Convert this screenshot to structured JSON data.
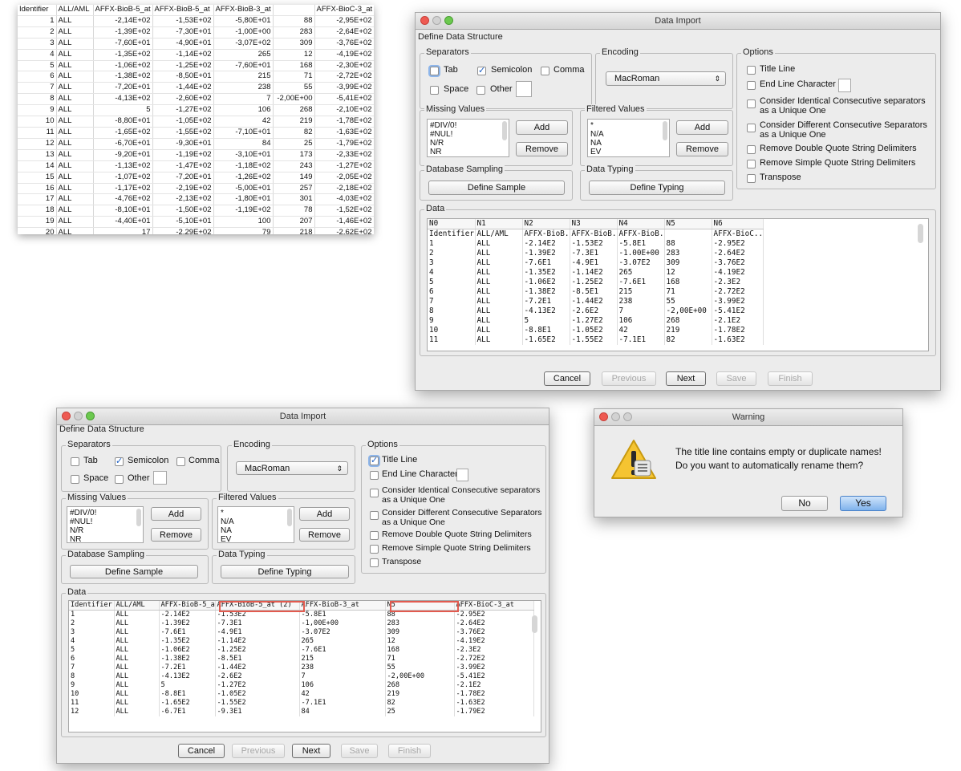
{
  "sheet": {
    "headers": [
      "Identifier",
      "ALL/AML",
      "AFFX-BioB-5_at",
      "AFFX-BioB-5_at",
      "AFFX-BioB-3_at",
      "",
      "AFFX-BioC-3_at"
    ],
    "rows": [
      [
        "1",
        "ALL",
        "-2,14E+02",
        "-1,53E+02",
        "-5,80E+01",
        "88",
        "-2,95E+02"
      ],
      [
        "2",
        "ALL",
        "-1,39E+02",
        "-7,30E+01",
        "-1,00E+00",
        "283",
        "-2,64E+02"
      ],
      [
        "3",
        "ALL",
        "-7,60E+01",
        "-4,90E+01",
        "-3,07E+02",
        "309",
        "-3,76E+02"
      ],
      [
        "4",
        "ALL",
        "-1,35E+02",
        "-1,14E+02",
        "265",
        "12",
        "-4,19E+02"
      ],
      [
        "5",
        "ALL",
        "-1,06E+02",
        "-1,25E+02",
        "-7,60E+01",
        "168",
        "-2,30E+02"
      ],
      [
        "6",
        "ALL",
        "-1,38E+02",
        "-8,50E+01",
        "215",
        "71",
        "-2,72E+02"
      ],
      [
        "7",
        "ALL",
        "-7,20E+01",
        "-1,44E+02",
        "238",
        "55",
        "-3,99E+02"
      ],
      [
        "8",
        "ALL",
        "-4,13E+02",
        "-2,60E+02",
        "7",
        "-2,00E+00",
        "-5,41E+02"
      ],
      [
        "9",
        "ALL",
        "5",
        "-1,27E+02",
        "106",
        "268",
        "-2,10E+02"
      ],
      [
        "10",
        "ALL",
        "-8,80E+01",
        "-1,05E+02",
        "42",
        "219",
        "-1,78E+02"
      ],
      [
        "11",
        "ALL",
        "-1,65E+02",
        "-1,55E+02",
        "-7,10E+01",
        "82",
        "-1,63E+02"
      ],
      [
        "12",
        "ALL",
        "-6,70E+01",
        "-9,30E+01",
        "84",
        "25",
        "-1,79E+02"
      ],
      [
        "13",
        "ALL",
        "-9,20E+01",
        "-1,19E+02",
        "-3,10E+01",
        "173",
        "-2,33E+02"
      ],
      [
        "14",
        "ALL",
        "-1,13E+02",
        "-1,47E+02",
        "-1,18E+02",
        "243",
        "-1,27E+02"
      ],
      [
        "15",
        "ALL",
        "-1,07E+02",
        "-7,20E+01",
        "-1,26E+02",
        "149",
        "-2,05E+02"
      ],
      [
        "16",
        "ALL",
        "-1,17E+02",
        "-2,19E+02",
        "-5,00E+01",
        "257",
        "-2,18E+02"
      ],
      [
        "17",
        "ALL",
        "-4,76E+02",
        "-2,13E+02",
        "-1,80E+01",
        "301",
        "-4,03E+02"
      ],
      [
        "18",
        "ALL",
        "-8,10E+01",
        "-1,50E+02",
        "-1,19E+02",
        "78",
        "-1,52E+02"
      ],
      [
        "19",
        "ALL",
        "-4,40E+01",
        "-5,10E+01",
        "100",
        "207",
        "-1,46E+02"
      ],
      [
        "20",
        "ALL",
        "17",
        "-2,29E+02",
        "79",
        "218",
        "-2,62E+02"
      ]
    ]
  },
  "dialog1": {
    "title": "Data Import",
    "subheader": "Define Data Structure",
    "separators": {
      "legend": "Separators",
      "tab": "Tab",
      "semicolon": "Semicolon",
      "comma": "Comma",
      "space": "Space",
      "other": "Other"
    },
    "encoding": {
      "legend": "Encoding",
      "value": "MacRoman"
    },
    "options": {
      "legend": "Options",
      "title_line": "Title Line",
      "end_line": "End Line Character",
      "identical_1": "Consider Identical Consecutive separators",
      "identical_2": "as a Unique One",
      "different_1": "Consider Different Consecutive Separators",
      "different_2": "as a Unique One",
      "double_quote": "Remove Double Quote String Delimiters",
      "simple_quote": "Remove Simple Quote String Delimiters",
      "transpose": "Transpose"
    },
    "missing": {
      "legend": "Missing Values",
      "items": [
        "#DIV/0!",
        "#NUL!",
        "N/R",
        "NR"
      ],
      "add": "Add",
      "remove": "Remove"
    },
    "filtered": {
      "legend": "Filtered Values",
      "items": [
        "*",
        "N/A",
        "NA",
        "EV"
      ],
      "add": "Add",
      "remove": "Remove"
    },
    "sampling": {
      "legend": "Database Sampling",
      "button": "Define Sample"
    },
    "typing": {
      "legend": "Data Typing",
      "button": "Define Typing"
    },
    "data": {
      "legend": "Data",
      "headers": [
        "N0",
        "N1",
        "N2",
        "N3",
        "N4",
        "N5",
        "N6"
      ],
      "rows": [
        [
          "Identifier",
          "ALL/AML",
          "AFFX-BioB...",
          "AFFX-BioB...",
          "AFFX-BioB...",
          "",
          "AFFX-BioC..."
        ],
        [
          "1",
          "ALL",
          "-2.14E2",
          "-1.53E2",
          "-5.8E1",
          "88",
          "-2.95E2"
        ],
        [
          "2",
          "ALL",
          "-1.39E2",
          "-7.3E1",
          "-1.00E+00",
          "283",
          "-2.64E2"
        ],
        [
          "3",
          "ALL",
          "-7.6E1",
          "-4.9E1",
          "-3.07E2",
          "309",
          "-3.76E2"
        ],
        [
          "4",
          "ALL",
          "-1.35E2",
          "-1.14E2",
          "265",
          "12",
          "-4.19E2"
        ],
        [
          "5",
          "ALL",
          "-1.06E2",
          "-1.25E2",
          "-7.6E1",
          "168",
          "-2.3E2"
        ],
        [
          "6",
          "ALL",
          "-1.38E2",
          "-8.5E1",
          "215",
          "71",
          "-2.72E2"
        ],
        [
          "7",
          "ALL",
          "-7.2E1",
          "-1.44E2",
          "238",
          "55",
          "-3.99E2"
        ],
        [
          "8",
          "ALL",
          "-4.13E2",
          "-2.6E2",
          "7",
          "-2,00E+00",
          "-5.41E2"
        ],
        [
          "9",
          "ALL",
          "5",
          "-1.27E2",
          "106",
          "268",
          "-2.1E2"
        ],
        [
          "10",
          "ALL",
          "-8.8E1",
          "-1.05E2",
          "42",
          "219",
          "-1.78E2"
        ],
        [
          "11",
          "ALL",
          "-1.65E2",
          "-1.55E2",
          "-7.1E1",
          "82",
          "-1.63E2"
        ]
      ]
    },
    "footer": {
      "cancel": "Cancel",
      "previous": "Previous",
      "next": "Next",
      "save": "Save",
      "finish": "Finish"
    }
  },
  "dialog2": {
    "title": "Data Import",
    "subheader": "Define Data Structure",
    "separators": {
      "legend": "Separators",
      "tab": "Tab",
      "semicolon": "Semicolon",
      "comma": "Comma",
      "space": "Space",
      "other": "Other"
    },
    "encoding": {
      "legend": "Encoding",
      "value": "MacRoman"
    },
    "options": {
      "legend": "Options",
      "title_line": "Title Line",
      "end_line": "End Line Character",
      "identical_1": "Consider Identical Consecutive separators",
      "identical_2": "as a Unique One",
      "different_1": "Consider Different Consecutive Separators",
      "different_2": "as a Unique One",
      "double_quote": "Remove Double Quote String Delimiters",
      "simple_quote": "Remove Simple Quote String Delimiters",
      "transpose": "Transpose"
    },
    "missing": {
      "legend": "Missing Values",
      "items": [
        "#DIV/0!",
        "#NUL!",
        "N/R",
        "NR"
      ],
      "add": "Add",
      "remove": "Remove"
    },
    "filtered": {
      "legend": "Filtered Values",
      "items": [
        "*",
        "N/A",
        "NA",
        "EV"
      ],
      "add": "Add",
      "remove": "Remove"
    },
    "sampling": {
      "legend": "Database Sampling",
      "button": "Define Sample"
    },
    "typing": {
      "legend": "Data Typing",
      "button": "Define Typing"
    },
    "data": {
      "legend": "Data",
      "headers": [
        "Identifier",
        "ALL/AML",
        "AFFX-BioB-5_at",
        "AFFX-BioB-5_at (2)",
        "AFFX-BioB-3_at",
        "N5",
        "AFFX-BioC-3_at"
      ],
      "rows": [
        [
          "1",
          "ALL",
          "-2.14E2",
          "-1.53E2",
          "-5.8E1",
          "88",
          "-2.95E2"
        ],
        [
          "2",
          "ALL",
          "-1.39E2",
          "-7.3E1",
          "-1,00E+00",
          "283",
          "-2.64E2"
        ],
        [
          "3",
          "ALL",
          "-7.6E1",
          "-4.9E1",
          "-3.07E2",
          "309",
          "-3.76E2"
        ],
        [
          "4",
          "ALL",
          "-1.35E2",
          "-1.14E2",
          "265",
          "12",
          "-4.19E2"
        ],
        [
          "5",
          "ALL",
          "-1.06E2",
          "-1.25E2",
          "-7.6E1",
          "168",
          "-2.3E2"
        ],
        [
          "6",
          "ALL",
          "-1.38E2",
          "-8.5E1",
          "215",
          "71",
          "-2.72E2"
        ],
        [
          "7",
          "ALL",
          "-7.2E1",
          "-1.44E2",
          "238",
          "55",
          "-3.99E2"
        ],
        [
          "8",
          "ALL",
          "-4.13E2",
          "-2.6E2",
          "7",
          "-2,00E+00",
          "-5.41E2"
        ],
        [
          "9",
          "ALL",
          "5",
          "-1.27E2",
          "106",
          "268",
          "-2.1E2"
        ],
        [
          "10",
          "ALL",
          "-8.8E1",
          "-1.05E2",
          "42",
          "219",
          "-1.78E2"
        ],
        [
          "11",
          "ALL",
          "-1.65E2",
          "-1.55E2",
          "-7.1E1",
          "82",
          "-1.63E2"
        ],
        [
          "12",
          "ALL",
          "-6.7E1",
          "-9.3E1",
          "84",
          "25",
          "-1.79E2"
        ]
      ]
    },
    "footer": {
      "cancel": "Cancel",
      "previous": "Previous",
      "next": "Next",
      "save": "Save",
      "finish": "Finish"
    }
  },
  "warning": {
    "title": "Warning",
    "line1": "The title line contains empty or duplicate names!",
    "line2": "Do you want to automatically rename them?",
    "no": "No",
    "yes": "Yes",
    "icon": "warning-triangle-icon"
  },
  "colors": {
    "highlight": "#e25a4f",
    "default_button": "#7fb2ec"
  }
}
